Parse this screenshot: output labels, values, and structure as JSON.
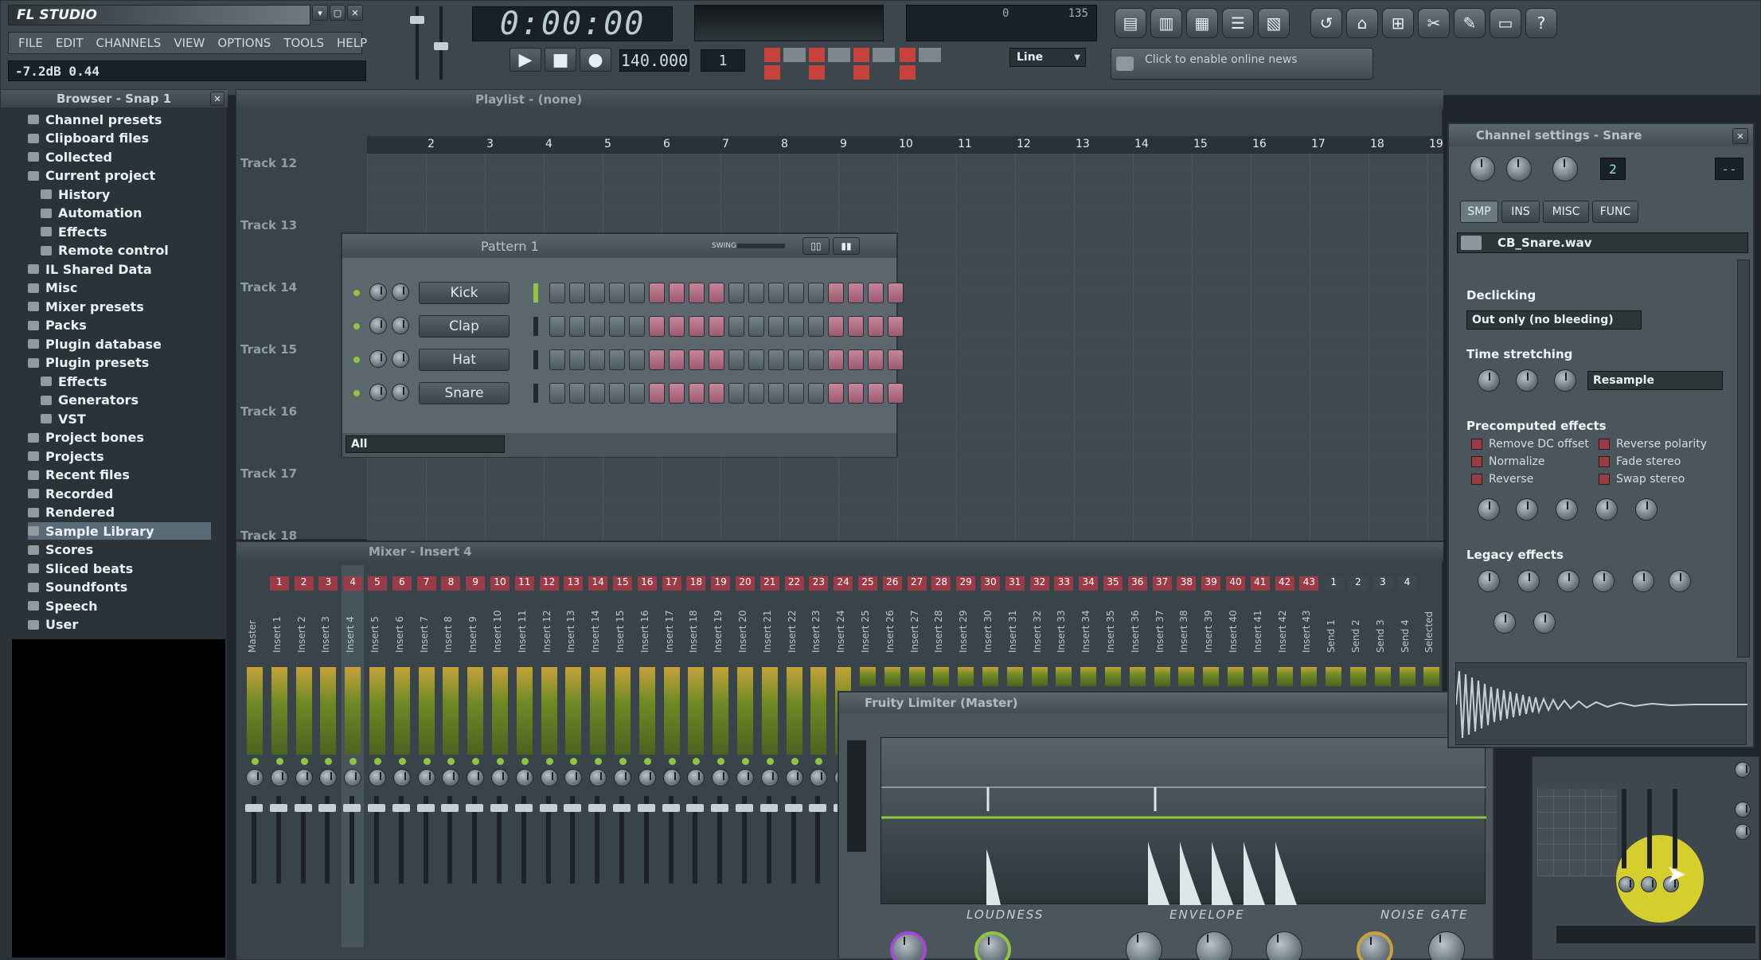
{
  "app": {
    "logo_text": "FL STUDIO"
  },
  "menu": [
    "FILE",
    "EDIT",
    "CHANNELS",
    "VIEW",
    "OPTIONS",
    "TOOLS",
    "HELP"
  ],
  "hint_bar": "-7.2dB 0.44",
  "transport": {
    "time": "0:00:00",
    "tempo": "140.000",
    "pattern": "1",
    "line_mode": "Line",
    "online_news": "Click to enable online news",
    "cpu_value": "0",
    "tempo_value": "135"
  },
  "browser": {
    "title": "Browser - Snap 1",
    "items": [
      {
        "label": "Channel presets",
        "indent": 0
      },
      {
        "label": "Clipboard files",
        "indent": 0
      },
      {
        "label": "Collected",
        "indent": 0
      },
      {
        "label": "Current project",
        "indent": 0
      },
      {
        "label": "History",
        "indent": 1
      },
      {
        "label": "Automation",
        "indent": 1
      },
      {
        "label": "Effects",
        "indent": 1
      },
      {
        "label": "Remote control",
        "indent": 1
      },
      {
        "label": "IL Shared Data",
        "indent": 0
      },
      {
        "label": "Misc",
        "indent": 0
      },
      {
        "label": "Mixer presets",
        "indent": 0
      },
      {
        "label": "Packs",
        "indent": 0
      },
      {
        "label": "Plugin database",
        "indent": 0
      },
      {
        "label": "Plugin presets",
        "indent": 0
      },
      {
        "label": "Effects",
        "indent": 1
      },
      {
        "label": "Generators",
        "indent": 1
      },
      {
        "label": "VST",
        "indent": 1
      },
      {
        "label": "Project bones",
        "indent": 0
      },
      {
        "label": "Projects",
        "indent": 0
      },
      {
        "label": "Recent files",
        "indent": 0
      },
      {
        "label": "Recorded",
        "indent": 0
      },
      {
        "label": "Rendered",
        "indent": 0
      },
      {
        "label": "Sample Library",
        "indent": 0
      },
      {
        "label": "Scores",
        "indent": 0
      },
      {
        "label": "Sliced beats",
        "indent": 0
      },
      {
        "label": "Soundfonts",
        "indent": 0
      },
      {
        "label": "Speech",
        "indent": 0
      },
      {
        "label": "User",
        "indent": 0
      }
    ],
    "selected": "Sample Library"
  },
  "playlist": {
    "title": "Playlist - (none)",
    "ruler": [
      "2",
      "3",
      "4",
      "5",
      "6",
      "7",
      "8",
      "9",
      "10",
      "11",
      "12",
      "13",
      "14",
      "15",
      "16",
      "17",
      "18",
      "19"
    ],
    "tracks": [
      "Track 12",
      "Track 13",
      "Track 14",
      "Track 15",
      "Track 16",
      "Track 17",
      "Track 18"
    ]
  },
  "step_sequencer": {
    "title": "Pattern 1",
    "swing_label": "SWING",
    "filter": "All",
    "channels": [
      {
        "name": "Kick",
        "steps": "gggggrrrrgggggrrrr"
      },
      {
        "name": "Clap",
        "steps": "gggggrrrrgggggrrrr"
      },
      {
        "name": "Hat",
        "steps": "gggggrrrrgggggrrrr"
      },
      {
        "name": "Snare",
        "steps": "gggggrrrrgggggrrrr"
      }
    ]
  },
  "mixer": {
    "title": "Mixer - Insert 4",
    "numbers": [
      "1",
      "2",
      "3",
      "4",
      "5",
      "6",
      "7",
      "8",
      "9",
      "10",
      "11",
      "12",
      "13",
      "14",
      "15",
      "16",
      "17",
      "18",
      "19",
      "20",
      "21",
      "22",
      "23",
      "24",
      "25",
      "26",
      "27",
      "28",
      "29",
      "30",
      "31",
      "32",
      "33",
      "34",
      "35",
      "36",
      "37",
      "38",
      "39",
      "40",
      "41",
      "42",
      "43",
      "1",
      "2",
      "3",
      "4"
    ],
    "strip_labels": [
      "Master",
      "Insert 1",
      "Insert 2",
      "Insert 3",
      "Insert 4",
      "Insert 5",
      "Insert 6",
      "Insert 7",
      "Insert 8",
      "Insert 9",
      "Insert 10",
      "Insert 11",
      "Insert 12",
      "Insert 13",
      "Insert 14",
      "Insert 15",
      "Insert 16",
      "Insert 17",
      "Insert 18",
      "Insert 19",
      "Insert 20",
      "Insert 21",
      "Insert 22",
      "Insert 23",
      "Insert 24",
      "Insert 25",
      "Insert 26",
      "Insert 27",
      "Insert 28",
      "Insert 29",
      "Insert 30",
      "Insert 31",
      "Insert 32",
      "Insert 33",
      "Insert 34",
      "Insert 35",
      "Insert 36",
      "Insert 37",
      "Insert 38",
      "Insert 39",
      "Insert 40",
      "Insert 41",
      "Insert 42",
      "Insert 43",
      "Send 1",
      "Send 2",
      "Send 3",
      "Send 4",
      "Selected"
    ]
  },
  "limiter": {
    "title": "Fruity Limiter (Master)",
    "sections": [
      "LOUDNESS",
      "ENVELOPE",
      "NOISE GATE"
    ]
  },
  "channel_settings": {
    "title": "Channel settings - Snare",
    "tabs": [
      "SMP",
      "INS",
      "MISC",
      "FUNC"
    ],
    "sample_name": "CB_Snare.wav",
    "declicking_title": "Declicking",
    "declicking_value": "Out only (no bleeding)",
    "time_stretching_title": "Time stretching",
    "time_stretching_mode": "Resample",
    "precomputed_title": "Precomputed effects",
    "precomputed_left": [
      "Remove DC offset",
      "Normalize",
      "Reverse"
    ],
    "precomputed_right": [
      "Reverse polarity",
      "Fade stereo",
      "Swap stereo"
    ],
    "legacy_title": "Legacy effects",
    "pitch_value": "2",
    "fx_value": "--"
  },
  "colors": {
    "accent": "#8ec63f",
    "step_red": "#c7879b",
    "meter_green": "#9bc238",
    "waveform": "#c8d0d6"
  }
}
